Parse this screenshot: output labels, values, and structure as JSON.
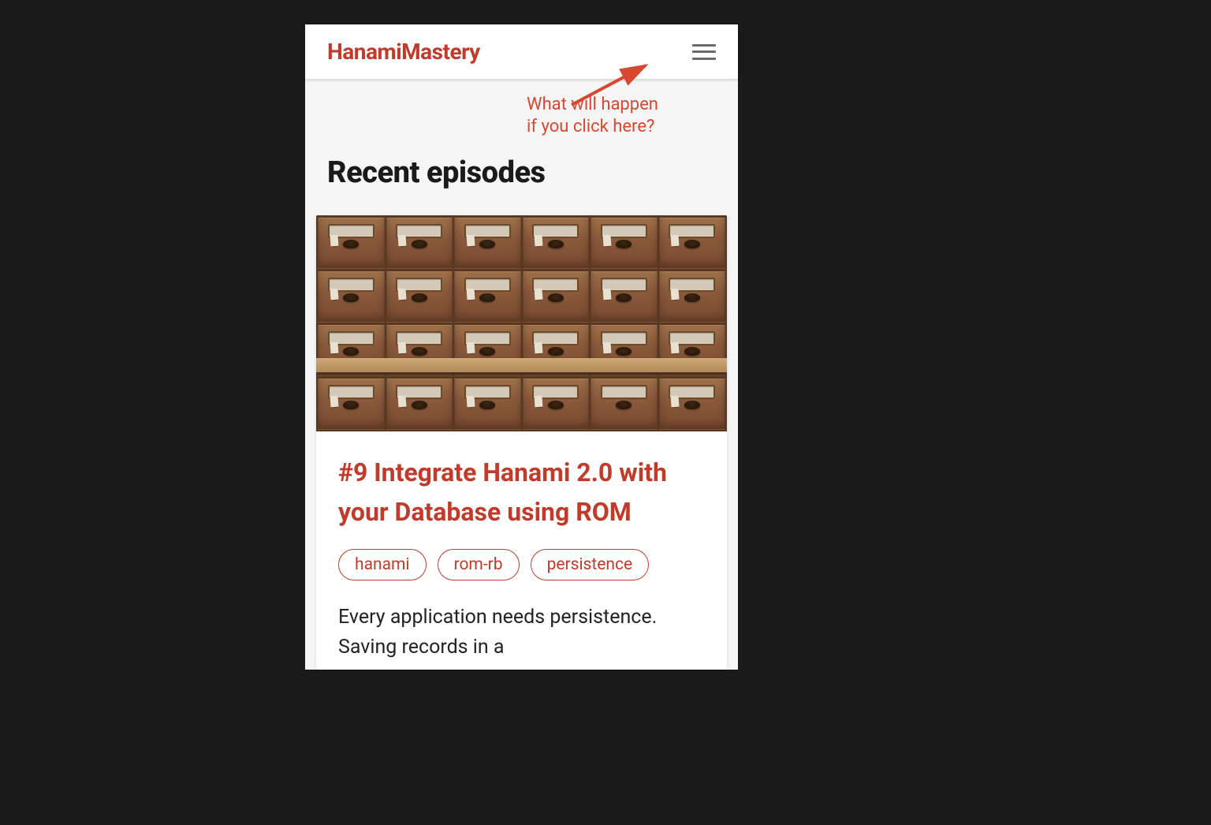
{
  "header": {
    "brand": "HanamiMastery"
  },
  "annotation": {
    "line1": "What will happen",
    "line2": "if you click here?"
  },
  "section": {
    "title": "Recent episodes"
  },
  "episode": {
    "title": "#9 Integrate Hanami 2.0 with your Database using ROM",
    "tags": [
      "hanami",
      "rom-rb",
      "persistence"
    ],
    "excerpt": "Every application needs persistence. Saving records in a"
  },
  "colors": {
    "accent": "#c23a2a",
    "background": "#1a1a1a"
  }
}
